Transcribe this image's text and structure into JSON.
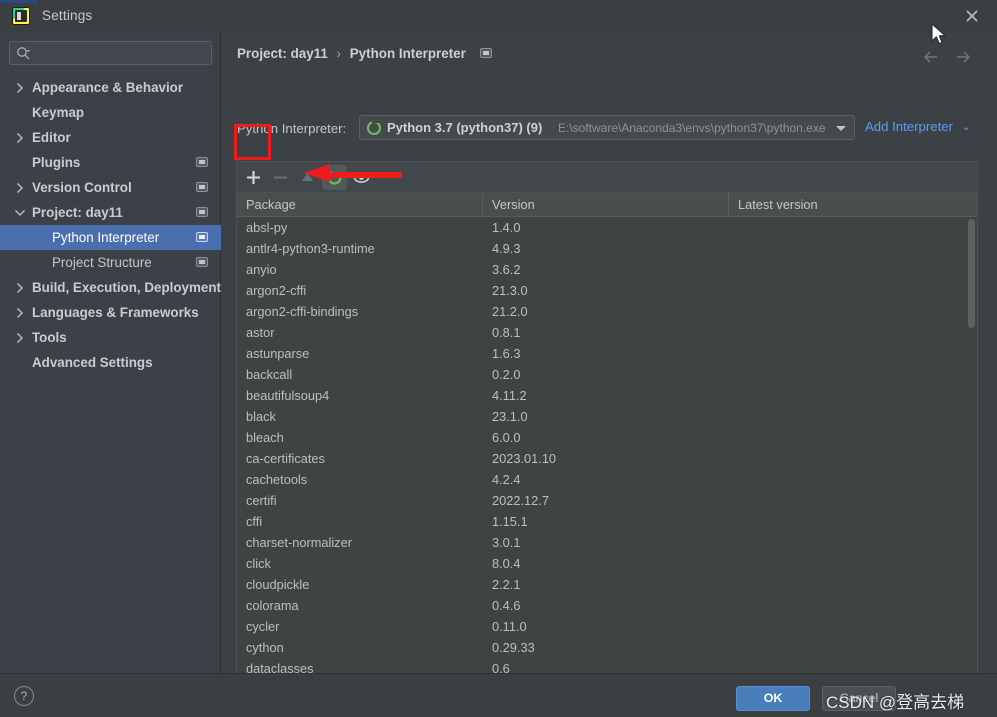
{
  "window": {
    "title": "Settings",
    "app_icon": "pycharm-icon",
    "close_label": "×"
  },
  "sidebar": {
    "search": {
      "value": "",
      "placeholder": ""
    },
    "items": [
      {
        "label": "Appearance & Behavior",
        "level": 0,
        "arrow": "right",
        "bold": true,
        "badge": false,
        "selected": false
      },
      {
        "label": "Keymap",
        "level": 0,
        "arrow": "none",
        "bold": true,
        "badge": false,
        "selected": false
      },
      {
        "label": "Editor",
        "level": 0,
        "arrow": "right",
        "bold": true,
        "badge": false,
        "selected": false
      },
      {
        "label": "Plugins",
        "level": 0,
        "arrow": "none",
        "bold": true,
        "badge": true,
        "selected": false
      },
      {
        "label": "Version Control",
        "level": 0,
        "arrow": "right",
        "bold": true,
        "badge": true,
        "selected": false
      },
      {
        "label": "Project: day11",
        "level": 0,
        "arrow": "down",
        "bold": true,
        "badge": true,
        "selected": false
      },
      {
        "label": "Python Interpreter",
        "level": 1,
        "arrow": "none",
        "bold": false,
        "badge": true,
        "selected": true
      },
      {
        "label": "Project Structure",
        "level": 1,
        "arrow": "none",
        "bold": false,
        "badge": true,
        "selected": false
      },
      {
        "label": "Build, Execution, Deployment",
        "level": 0,
        "arrow": "right",
        "bold": true,
        "badge": false,
        "selected": false
      },
      {
        "label": "Languages & Frameworks",
        "level": 0,
        "arrow": "right",
        "bold": true,
        "badge": false,
        "selected": false
      },
      {
        "label": "Tools",
        "level": 0,
        "arrow": "right",
        "bold": true,
        "badge": false,
        "selected": false
      },
      {
        "label": "Advanced Settings",
        "level": 0,
        "arrow": "none",
        "bold": true,
        "badge": false,
        "selected": false
      }
    ]
  },
  "main": {
    "breadcrumb": {
      "root": "Project: day11",
      "separator": "›",
      "leaf": "Python Interpreter"
    },
    "interpreter": {
      "label": "Python Interpreter:",
      "name": "Python 3.7 (python37) (9)",
      "path": "E:\\software\\Anaconda3\\envs\\python37\\python.exe",
      "add_label": "Add Interpreter",
      "add_chevron": "⌄"
    },
    "toolbar": {
      "add_label": "+",
      "remove_label": "−",
      "upgrade_label": "▲",
      "conda_label": "conda-icon",
      "show_early_label": "eye-icon"
    },
    "table": {
      "columns": [
        "Package",
        "Version",
        "Latest version"
      ],
      "rows": [
        {
          "package": "absl-py",
          "version": "1.4.0",
          "latest": ""
        },
        {
          "package": "antlr4-python3-runtime",
          "version": "4.9.3",
          "latest": ""
        },
        {
          "package": "anyio",
          "version": "3.6.2",
          "latest": ""
        },
        {
          "package": "argon2-cffi",
          "version": "21.3.0",
          "latest": ""
        },
        {
          "package": "argon2-cffi-bindings",
          "version": "21.2.0",
          "latest": ""
        },
        {
          "package": "astor",
          "version": "0.8.1",
          "latest": ""
        },
        {
          "package": "astunparse",
          "version": "1.6.3",
          "latest": ""
        },
        {
          "package": "backcall",
          "version": "0.2.0",
          "latest": ""
        },
        {
          "package": "beautifulsoup4",
          "version": "4.11.2",
          "latest": ""
        },
        {
          "package": "black",
          "version": "23.1.0",
          "latest": ""
        },
        {
          "package": "bleach",
          "version": "6.0.0",
          "latest": ""
        },
        {
          "package": "ca-certificates",
          "version": "2023.01.10",
          "latest": ""
        },
        {
          "package": "cachetools",
          "version": "4.2.4",
          "latest": ""
        },
        {
          "package": "certifi",
          "version": "2022.12.7",
          "latest": ""
        },
        {
          "package": "cffi",
          "version": "1.15.1",
          "latest": ""
        },
        {
          "package": "charset-normalizer",
          "version": "3.0.1",
          "latest": ""
        },
        {
          "package": "click",
          "version": "8.0.4",
          "latest": ""
        },
        {
          "package": "cloudpickle",
          "version": "2.2.1",
          "latest": ""
        },
        {
          "package": "colorama",
          "version": "0.4.6",
          "latest": ""
        },
        {
          "package": "cycler",
          "version": "0.11.0",
          "latest": ""
        },
        {
          "package": "cython",
          "version": "0.29.33",
          "latest": ""
        },
        {
          "package": "dataclasses",
          "version": "0.6",
          "latest": ""
        }
      ]
    }
  },
  "footer": {
    "help_label": "?",
    "ok_label": "OK",
    "cancel_label": "Cancel",
    "watermark": "CSDN @登高去梯"
  },
  "colors": {
    "accent_blue": "#4b6eaf",
    "link_blue": "#589df6",
    "ok_button": "#4a7ebb",
    "annotation_red": "#ee1c1c",
    "python_green": "#6cbf5a"
  }
}
